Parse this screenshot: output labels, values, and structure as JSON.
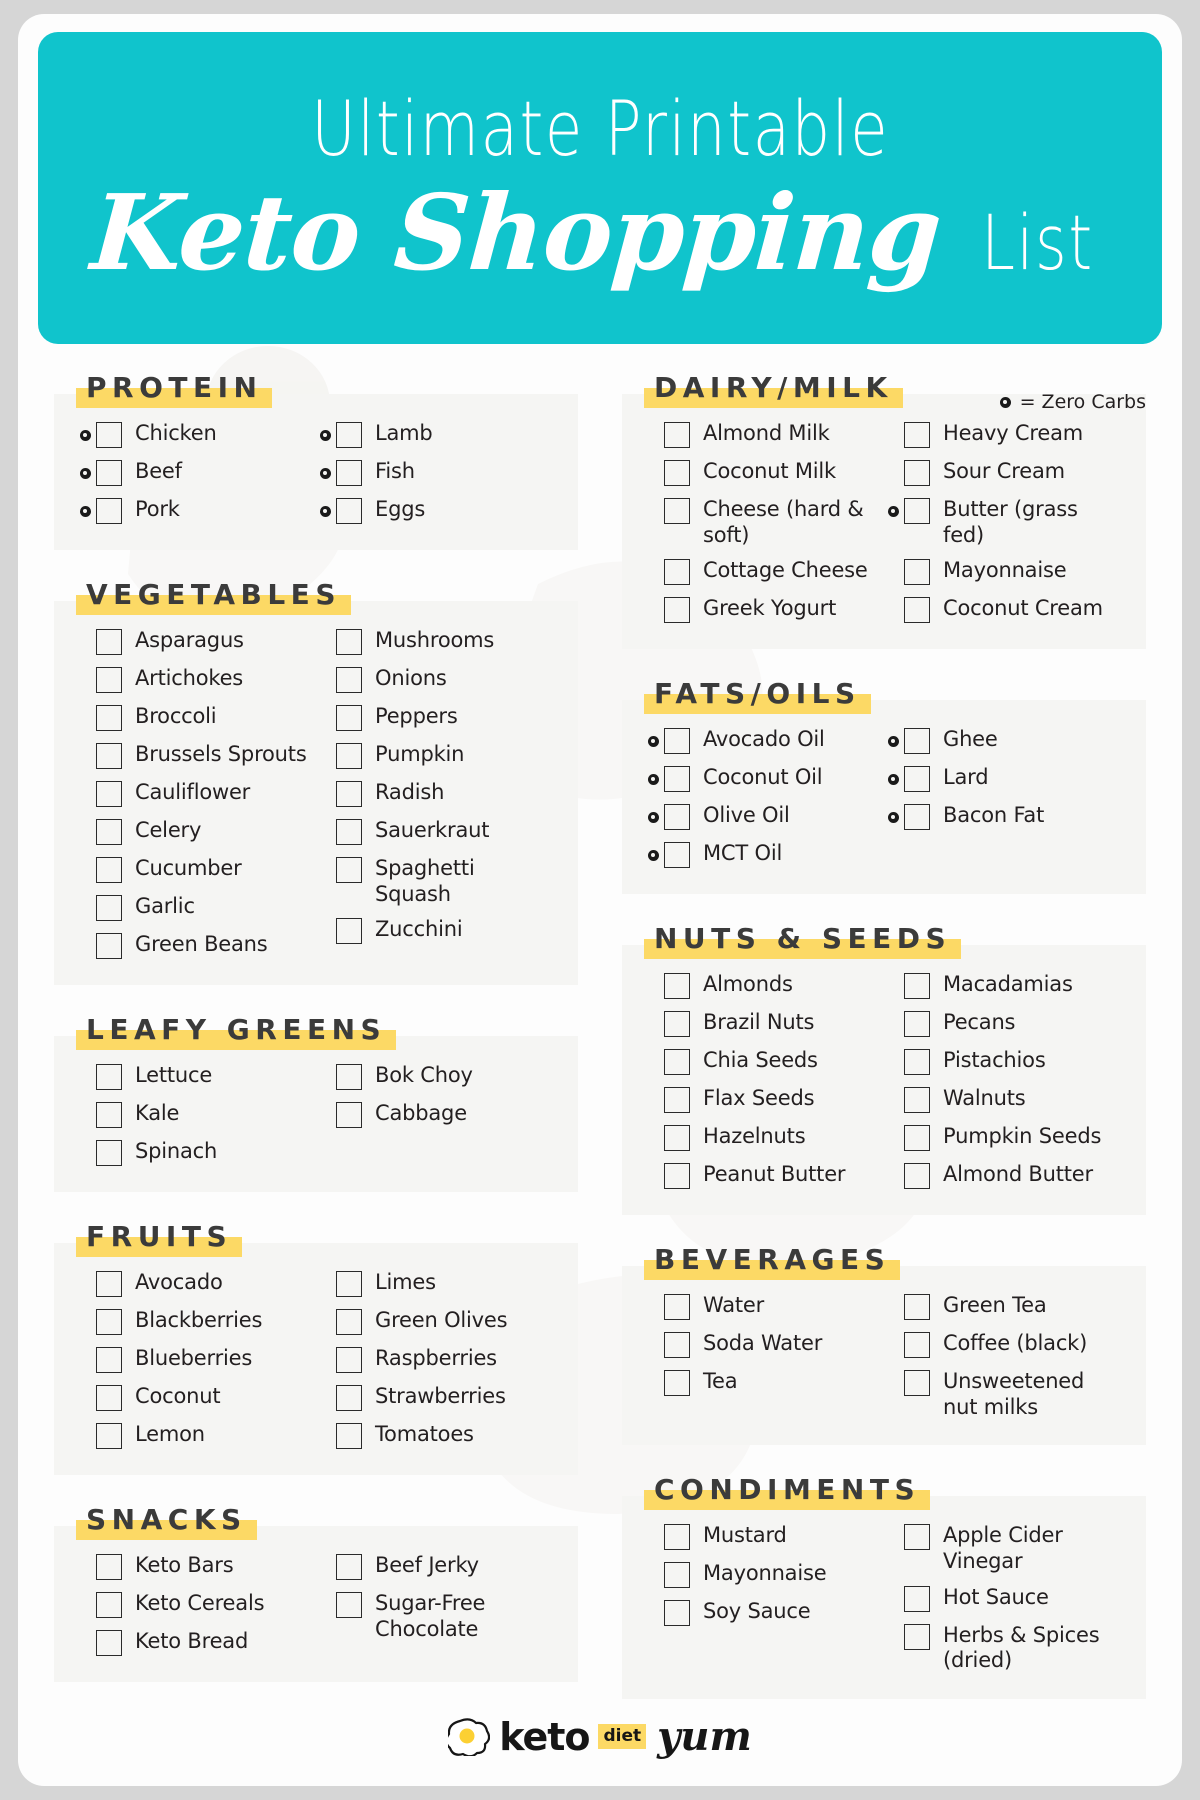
{
  "header": {
    "title_top": "Ultimate Printable",
    "title_script": "Keto Shopping",
    "title_list": "List",
    "bg_color": "#10c4cc"
  },
  "legend": {
    "text": "= Zero Carbs",
    "icon": "zero-carb-dot-icon"
  },
  "theme": {
    "accent": "#10c4cc",
    "highlight": "#fcd965",
    "card_bg": "#f5f5f3",
    "page_bg": "#d6d6d6",
    "text": "#231f20"
  },
  "footer": {
    "logo_icon": "fried-egg-icon",
    "logo_keto": "keto",
    "logo_diet": "diet",
    "logo_yum": "yum"
  },
  "left_sections": [
    {
      "title": "PROTEIN",
      "left": [
        {
          "label": "Chicken",
          "zero": true
        },
        {
          "label": "Beef",
          "zero": true
        },
        {
          "label": "Pork",
          "zero": true
        }
      ],
      "right": [
        {
          "label": "Lamb",
          "zero": true
        },
        {
          "label": "Fish",
          "zero": true
        },
        {
          "label": "Eggs",
          "zero": true
        }
      ]
    },
    {
      "title": "VEGETABLES",
      "left": [
        {
          "label": "Asparagus",
          "zero": false
        },
        {
          "label": "Artichokes",
          "zero": false
        },
        {
          "label": "Broccoli",
          "zero": false
        },
        {
          "label": "Brussels Sprouts",
          "zero": false
        },
        {
          "label": "Cauliflower",
          "zero": false
        },
        {
          "label": "Celery",
          "zero": false
        },
        {
          "label": "Cucumber",
          "zero": false
        },
        {
          "label": "Garlic",
          "zero": false
        },
        {
          "label": "Green Beans",
          "zero": false
        }
      ],
      "right": [
        {
          "label": "Mushrooms",
          "zero": false
        },
        {
          "label": "Onions",
          "zero": false
        },
        {
          "label": "Peppers",
          "zero": false
        },
        {
          "label": "Pumpkin",
          "zero": false
        },
        {
          "label": "Radish",
          "zero": false
        },
        {
          "label": "Sauerkraut",
          "zero": false
        },
        {
          "label": "Spaghetti Squash",
          "zero": false
        },
        {
          "label": "Zucchini",
          "zero": false
        }
      ]
    },
    {
      "title": "LEAFY GREENS",
      "left": [
        {
          "label": "Lettuce",
          "zero": false
        },
        {
          "label": "Kale",
          "zero": false
        },
        {
          "label": "Spinach",
          "zero": false
        }
      ],
      "right": [
        {
          "label": "Bok Choy",
          "zero": false
        },
        {
          "label": "Cabbage",
          "zero": false
        }
      ]
    },
    {
      "title": "FRUITS",
      "left": [
        {
          "label": "Avocado",
          "zero": false
        },
        {
          "label": "Blackberries",
          "zero": false
        },
        {
          "label": "Blueberries",
          "zero": false
        },
        {
          "label": "Coconut",
          "zero": false
        },
        {
          "label": "Lemon",
          "zero": false
        }
      ],
      "right": [
        {
          "label": "Limes",
          "zero": false
        },
        {
          "label": "Green Olives",
          "zero": false
        },
        {
          "label": "Raspberries",
          "zero": false
        },
        {
          "label": "Strawberries",
          "zero": false
        },
        {
          "label": "Tomatoes",
          "zero": false
        }
      ]
    },
    {
      "title": "SNACKS",
      "left": [
        {
          "label": "Keto Bars",
          "zero": false
        },
        {
          "label": "Keto Cereals",
          "zero": false
        },
        {
          "label": "Keto Bread",
          "zero": false
        }
      ],
      "right": [
        {
          "label": "Beef Jerky",
          "zero": false
        },
        {
          "label": "Sugar-Free Chocolate",
          "zero": false
        }
      ]
    }
  ],
  "right_sections": [
    {
      "title": "DAIRY/MILK",
      "left": [
        {
          "label": "Almond Milk",
          "zero": false
        },
        {
          "label": "Coconut Milk",
          "zero": false
        },
        {
          "label": "Cheese (hard & soft)",
          "zero": false
        },
        {
          "label": "Cottage Cheese",
          "zero": false
        },
        {
          "label": "Greek Yogurt",
          "zero": false
        }
      ],
      "right": [
        {
          "label": "Heavy Cream",
          "zero": false
        },
        {
          "label": "Sour Cream",
          "zero": false
        },
        {
          "label": "Butter (grass fed)",
          "zero": true
        },
        {
          "label": "Mayonnaise",
          "zero": false
        },
        {
          "label": "Coconut Cream",
          "zero": false
        }
      ]
    },
    {
      "title": "FATS/OILS",
      "left": [
        {
          "label": "Avocado Oil",
          "zero": true
        },
        {
          "label": "Coconut Oil",
          "zero": true
        },
        {
          "label": "Olive Oil",
          "zero": true
        },
        {
          "label": "MCT Oil",
          "zero": true
        }
      ],
      "right": [
        {
          "label": "Ghee",
          "zero": true
        },
        {
          "label": "Lard",
          "zero": true
        },
        {
          "label": "Bacon Fat",
          "zero": true
        }
      ]
    },
    {
      "title": "NUTS & SEEDS",
      "left": [
        {
          "label": "Almonds",
          "zero": false
        },
        {
          "label": "Brazil Nuts",
          "zero": false
        },
        {
          "label": "Chia Seeds",
          "zero": false
        },
        {
          "label": "Flax Seeds",
          "zero": false
        },
        {
          "label": "Hazelnuts",
          "zero": false
        },
        {
          "label": "Peanut Butter",
          "zero": false
        }
      ],
      "right": [
        {
          "label": "Macadamias",
          "zero": false
        },
        {
          "label": "Pecans",
          "zero": false
        },
        {
          "label": "Pistachios",
          "zero": false
        },
        {
          "label": "Walnuts",
          "zero": false
        },
        {
          "label": "Pumpkin Seeds",
          "zero": false
        },
        {
          "label": "Almond Butter",
          "zero": false
        }
      ]
    },
    {
      "title": "BEVERAGES",
      "left": [
        {
          "label": "Water",
          "zero": false
        },
        {
          "label": "Soda Water",
          "zero": false
        },
        {
          "label": "Tea",
          "zero": false
        }
      ],
      "right": [
        {
          "label": "Green Tea",
          "zero": false
        },
        {
          "label": "Coffee (black)",
          "zero": false
        },
        {
          "label": "Unsweetened nut milks",
          "zero": false
        }
      ]
    },
    {
      "title": "CONDIMENTS",
      "left": [
        {
          "label": "Mustard",
          "zero": false
        },
        {
          "label": "Mayonnaise",
          "zero": false
        },
        {
          "label": "Soy Sauce",
          "zero": false
        }
      ],
      "right": [
        {
          "label": "Apple Cider Vinegar",
          "zero": false
        },
        {
          "label": "Hot Sauce",
          "zero": false
        },
        {
          "label": "Herbs & Spices (dried)",
          "zero": false
        }
      ]
    }
  ]
}
